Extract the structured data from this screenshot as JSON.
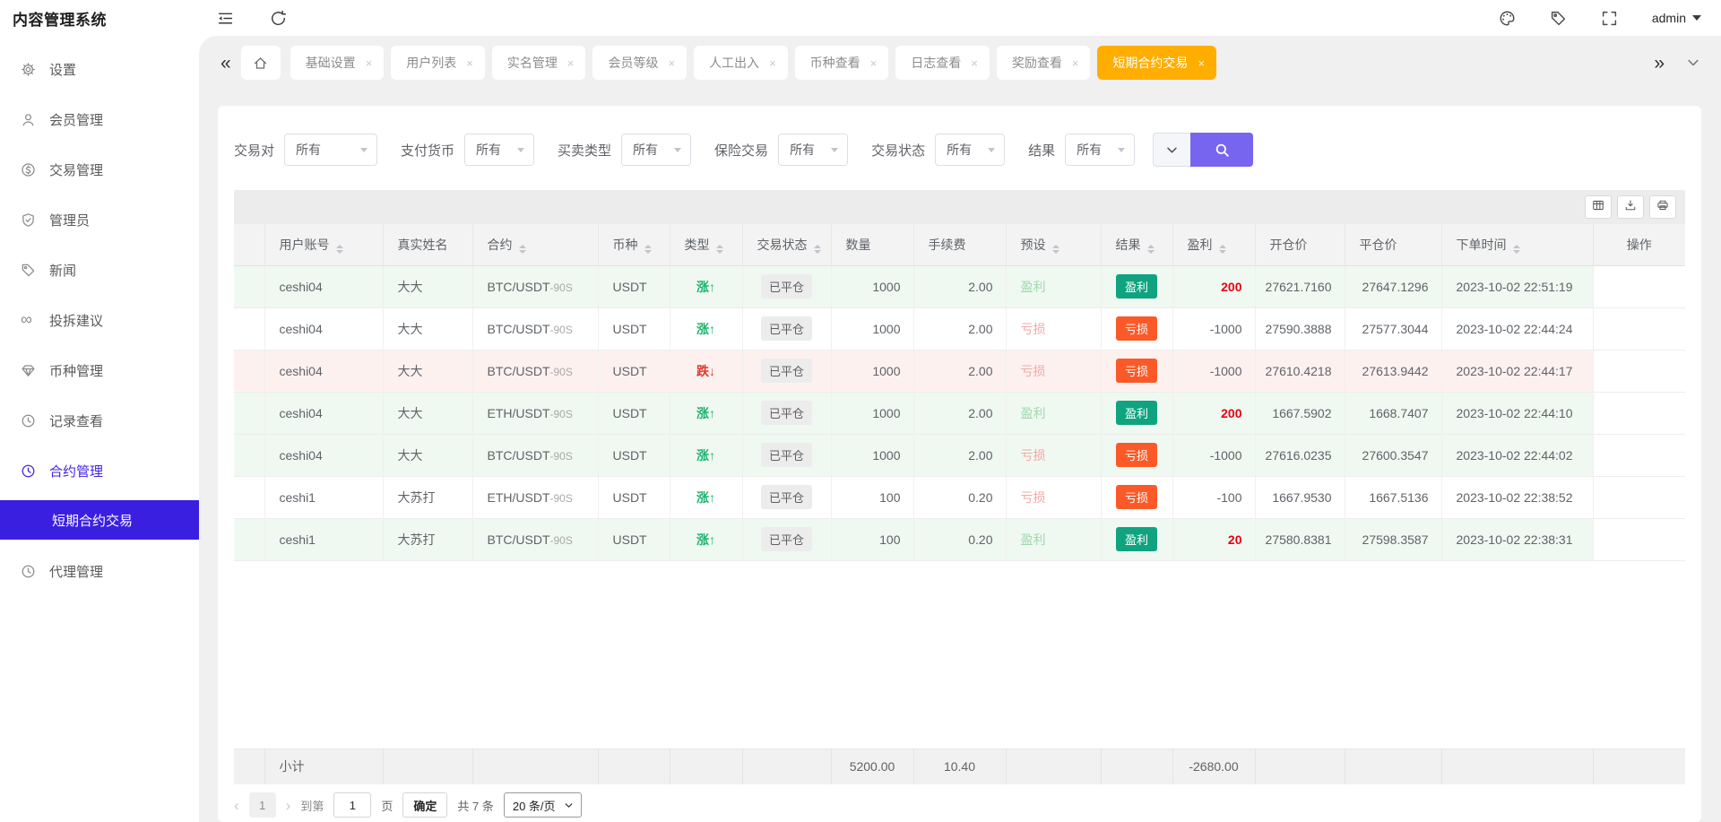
{
  "header": {
    "title": "内容管理系统",
    "user": "admin"
  },
  "tabbar": {
    "back": "«",
    "forward": "»",
    "tabs": [
      {
        "key": "basic-settings",
        "label": "基础设置",
        "active": false
      },
      {
        "key": "user-list",
        "label": "用户列表",
        "active": false
      },
      {
        "key": "realname-management",
        "label": "实名管理",
        "active": false
      },
      {
        "key": "member-level",
        "label": "会员等级",
        "active": false
      },
      {
        "key": "manual-in-out",
        "label": "人工出入",
        "active": false
      },
      {
        "key": "coin-view",
        "label": "币种查看",
        "active": false
      },
      {
        "key": "log-view",
        "label": "日志查看",
        "active": false
      },
      {
        "key": "reward-view",
        "label": "奖励查看",
        "active": false
      },
      {
        "key": "short-contract-trade",
        "label": "短期合约交易",
        "active": true
      }
    ]
  },
  "sidebar": {
    "items": [
      {
        "key": "settings",
        "label": "设置",
        "icon": "gear-icon"
      },
      {
        "key": "member-management",
        "label": "会员管理",
        "icon": "user-icon"
      },
      {
        "key": "trade-management",
        "label": "交易管理",
        "icon": "coin-icon"
      },
      {
        "key": "admin-management",
        "label": "管理员",
        "icon": "shield-icon"
      },
      {
        "key": "news",
        "label": "新闻",
        "icon": "tag-icon"
      },
      {
        "key": "feedback",
        "label": "投拆建议",
        "icon": "infinity-icon"
      },
      {
        "key": "coin-management",
        "label": "币种管理",
        "icon": "diamond-icon"
      },
      {
        "key": "record-view",
        "label": "记录查看",
        "icon": "clock-icon"
      },
      {
        "key": "contract-management",
        "label": "合约管理",
        "icon": "clock-icon",
        "active": true
      },
      {
        "key": "short-contract-trade",
        "label": "短期合约交易",
        "submenu": true,
        "selected": true
      },
      {
        "key": "agent-management",
        "label": "代理管理",
        "icon": "clock-icon"
      }
    ]
  },
  "filters": [
    {
      "key": "trade-pair",
      "label": "交易对",
      "value": "所有",
      "wide": true
    },
    {
      "key": "pay-currency",
      "label": "支付货币",
      "value": "所有"
    },
    {
      "key": "trade-type",
      "label": "买卖类型",
      "value": "所有"
    },
    {
      "key": "insurance-trade",
      "label": "保险交易",
      "value": "所有"
    },
    {
      "key": "trade-status",
      "label": "交易状态",
      "value": "所有"
    },
    {
      "key": "result",
      "label": "结果",
      "value": "所有"
    }
  ],
  "toolbar": {
    "icons": [
      "grid-icon",
      "download-icon",
      "printer-icon"
    ]
  },
  "table": {
    "columns": [
      {
        "key": "expand",
        "label": "",
        "sortable": false
      },
      {
        "key": "account",
        "label": "用户账号",
        "sortable": true
      },
      {
        "key": "realname",
        "label": "真实姓名",
        "sortable": false
      },
      {
        "key": "contract",
        "label": "合约",
        "sortable": true
      },
      {
        "key": "coin",
        "label": "币种",
        "sortable": true
      },
      {
        "key": "type",
        "label": "类型",
        "sortable": true
      },
      {
        "key": "trade-status",
        "label": "交易状态",
        "sortable": true
      },
      {
        "key": "amount",
        "label": "数量",
        "sortable": false
      },
      {
        "key": "fee",
        "label": "手续费",
        "sortable": false
      },
      {
        "key": "preset",
        "label": "预设",
        "sortable": true
      },
      {
        "key": "result",
        "label": "结果",
        "sortable": true
      },
      {
        "key": "profit",
        "label": "盈利",
        "sortable": true
      },
      {
        "key": "open-price",
        "label": "开仓价",
        "sortable": false
      },
      {
        "key": "close-price",
        "label": "平仓价",
        "sortable": false
      },
      {
        "key": "order-time",
        "label": "下单时间",
        "sortable": true
      },
      {
        "key": "actions",
        "label": "操作",
        "sortable": false
      }
    ],
    "rows": [
      {
        "account": "ceshi04",
        "name": "大大",
        "contract": "BTC/USDT",
        "contract_suffix": "-90S",
        "currency": "USDT",
        "type": "涨",
        "type_arrow": "↑",
        "type_dir": "up",
        "status": "已平仓",
        "qty": "1000",
        "fee": "2.00",
        "preset": "盈利",
        "preset_tone": "win",
        "result": "盈利",
        "result_tone": "win",
        "profit": "200",
        "profit_tone": "win",
        "open": "27621.7160",
        "close": "27647.1296",
        "time": "2023-10-02 22:51:19",
        "tint": "green"
      },
      {
        "account": "ceshi04",
        "name": "大大",
        "contract": "BTC/USDT",
        "contract_suffix": "-90S",
        "currency": "USDT",
        "type": "涨",
        "type_arrow": "↑",
        "type_dir": "up",
        "status": "已平仓",
        "qty": "1000",
        "fee": "2.00",
        "preset": "亏损",
        "preset_tone": "loss",
        "result": "亏损",
        "result_tone": "loss",
        "profit": "-1000",
        "profit_tone": "loss",
        "open": "27590.3888",
        "close": "27577.3044",
        "time": "2023-10-02 22:44:24",
        "tint": "white"
      },
      {
        "account": "ceshi04",
        "name": "大大",
        "contract": "BTC/USDT",
        "contract_suffix": "-90S",
        "currency": "USDT",
        "type": "跌",
        "type_arrow": "↓",
        "type_dir": "down",
        "status": "已平仓",
        "qty": "1000",
        "fee": "2.00",
        "preset": "亏损",
        "preset_tone": "loss",
        "result": "亏损",
        "result_tone": "loss",
        "profit": "-1000",
        "profit_tone": "loss",
        "open": "27610.4218",
        "close": "27613.9442",
        "time": "2023-10-02 22:44:17",
        "tint": "pink"
      },
      {
        "account": "ceshi04",
        "name": "大大",
        "contract": "ETH/USDT",
        "contract_suffix": "-90S",
        "currency": "USDT",
        "type": "涨",
        "type_arrow": "↑",
        "type_dir": "up",
        "status": "已平仓",
        "qty": "1000",
        "fee": "2.00",
        "preset": "盈利",
        "preset_tone": "win",
        "result": "盈利",
        "result_tone": "win",
        "profit": "200",
        "profit_tone": "win",
        "open": "1667.5902",
        "close": "1668.7407",
        "time": "2023-10-02 22:44:10",
        "tint": "green"
      },
      {
        "account": "ceshi04",
        "name": "大大",
        "contract": "BTC/USDT",
        "contract_suffix": "-90S",
        "currency": "USDT",
        "type": "涨",
        "type_arrow": "↑",
        "type_dir": "up",
        "status": "已平仓",
        "qty": "1000",
        "fee": "2.00",
        "preset": "亏损",
        "preset_tone": "loss",
        "result": "亏损",
        "result_tone": "loss",
        "profit": "-1000",
        "profit_tone": "loss",
        "open": "27616.0235",
        "close": "27600.3547",
        "time": "2023-10-02 22:44:02",
        "tint": "green"
      },
      {
        "account": "ceshi1",
        "name": "大苏打",
        "contract": "ETH/USDT",
        "contract_suffix": "-90S",
        "currency": "USDT",
        "type": "涨",
        "type_arrow": "↑",
        "type_dir": "up",
        "status": "已平仓",
        "qty": "100",
        "fee": "0.20",
        "preset": "亏损",
        "preset_tone": "loss",
        "result": "亏损",
        "result_tone": "loss",
        "profit": "-100",
        "profit_tone": "loss",
        "open": "1667.9530",
        "close": "1667.5136",
        "time": "2023-10-02 22:38:52",
        "tint": "white"
      },
      {
        "account": "ceshi1",
        "name": "大苏打",
        "contract": "BTC/USDT",
        "contract_suffix": "-90S",
        "currency": "USDT",
        "type": "涨",
        "type_arrow": "↑",
        "type_dir": "up",
        "status": "已平仓",
        "qty": "100",
        "fee": "0.20",
        "preset": "盈利",
        "preset_tone": "win",
        "result": "盈利",
        "result_tone": "win",
        "profit": "20",
        "profit_tone": "win",
        "open": "27580.8381",
        "close": "27598.3587",
        "time": "2023-10-02 22:38:31",
        "tint": "green"
      }
    ],
    "subtotal": {
      "label": "小计",
      "qty": "5200.00",
      "fee": "10.40",
      "profit": "-2680.00"
    }
  },
  "pagination": {
    "prev": "‹",
    "page": "1",
    "next": "›",
    "goto_label": "到第",
    "goto_value": "1",
    "page_unit": "页",
    "confirm_label": "确定",
    "total_label": "共 7 条",
    "page_size": "20 条/页"
  },
  "colors": {
    "accent_purple": "#3b1fe0",
    "search_purple": "#7765f0",
    "active_tab_amber": "#ffae00",
    "win_teal": "#10a37f",
    "loss_orange": "#fb5a28",
    "up_green": "#1cb46f",
    "down_red": "#e0392b",
    "profit_red": "#e60012",
    "row_green_tint": "#eff8f1",
    "row_pink_tint": "#fdf1f0"
  }
}
